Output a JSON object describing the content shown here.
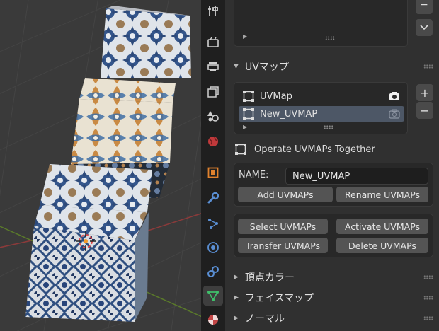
{
  "viewport": {
    "label": "3D Viewport"
  },
  "property_tabs": [
    {
      "name": "tool-tab-icon"
    },
    {
      "name": "render-tab-icon"
    },
    {
      "name": "output-tab-icon"
    },
    {
      "name": "view-layer-tab-icon"
    },
    {
      "name": "scene-tab-icon"
    },
    {
      "name": "world-tab-icon"
    },
    {
      "name": "object-tab-icon"
    },
    {
      "name": "modifier-tab-icon"
    },
    {
      "name": "particles-tab-icon"
    },
    {
      "name": "physics-tab-icon"
    },
    {
      "name": "constraints-tab-icon"
    },
    {
      "name": "data-tab-icon"
    },
    {
      "name": "material-tab-icon"
    }
  ],
  "uvmap_section": {
    "title": "UVマップ",
    "items": [
      {
        "label": "UVMap",
        "selected": false,
        "active_render": true
      },
      {
        "label": "New_UVMAP",
        "selected": true,
        "active_render": false
      }
    ],
    "add_symbol": "+",
    "remove_symbol": "−"
  },
  "addon": {
    "operate_together_label": "Operate UVMAPs Together",
    "name_label": "NAME:",
    "name_value": "New_UVMAP",
    "add_button": "Add UVMAPs",
    "rename_button": "Rename UVMAPs",
    "select_button": "Select UVMAPs",
    "activate_button": "Activate UVMAPs",
    "transfer_button": "Transfer UVMAPs",
    "delete_button": "Delete UVMAPs"
  },
  "collapsed_sections": [
    {
      "label": "頂点カラー"
    },
    {
      "label": "フェイスマップ"
    },
    {
      "label": "ノーマル"
    }
  ],
  "colors": {
    "panel_bg": "#303030",
    "box_bg": "#282828",
    "button_bg": "#545454",
    "selected_row": "#4d5766",
    "tile_blue": "#34568c",
    "tile_orange": "#c07a3a"
  }
}
